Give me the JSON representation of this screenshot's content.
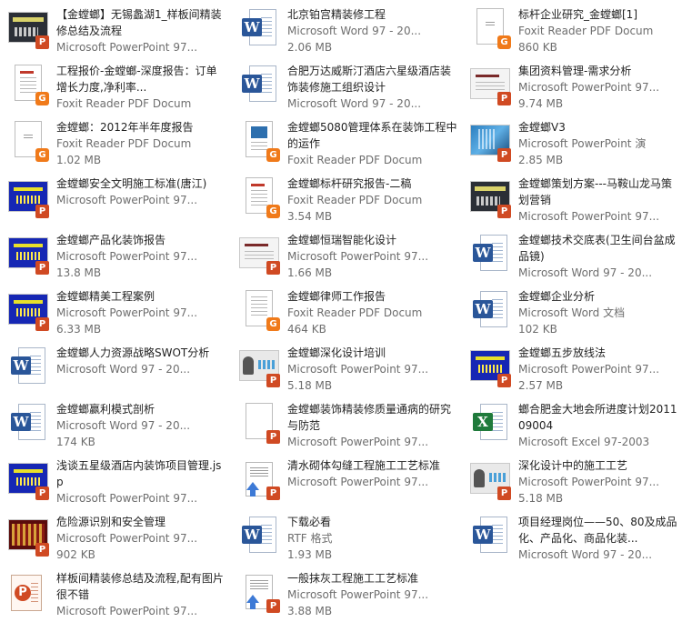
{
  "files": [
    {
      "name": "【金螳螂】无锡蠡湖1_样板间精装修总结及流程",
      "type": "Microsoft PowerPoint 97...",
      "size": "",
      "icon": "ppt-thumb-dark"
    },
    {
      "name": "北京铂宫精装修工程",
      "type": "Microsoft Word 97 - 20...",
      "size": "2.06 MB",
      "icon": "word-doc"
    },
    {
      "name": "标杆企业研究_金螳螂[1]",
      "type": "Foxit Reader PDF Docum",
      "size": "860 KB",
      "icon": "pdf-page-sparse"
    },
    {
      "name": "工程报价-金螳螂-深度报告：订单增长力度,净利率...",
      "type": "Foxit Reader PDF Docum",
      "size": "",
      "icon": "pdf-page-redhead"
    },
    {
      "name": "合肥万达威斯汀酒店六星级酒店装饰装修施工组织设计",
      "type": "Microsoft Word 97 - 20...",
      "size": "",
      "icon": "word-doc"
    },
    {
      "name": "集团资料管理-需求分析",
      "type": "Microsoft PowerPoint 97...",
      "size": "9.74 MB",
      "icon": "ppt-thumb-light"
    },
    {
      "name": "金螳螂：2012年半年度报告",
      "type": "Foxit Reader PDF Docum",
      "size": "1.02 MB",
      "icon": "pdf-page-sparse"
    },
    {
      "name": "金螳螂5080管理体系在装饰工程中的运作",
      "type": "Foxit Reader PDF Docum",
      "size": "",
      "icon": "pdf-page-cover"
    },
    {
      "name": "金螳螂V3",
      "type": "Microsoft PowerPoint 演",
      "size": "2.85 MB",
      "icon": "ppt-thumb-photo"
    },
    {
      "name": "金螳螂安全文明施工标准(唐江)",
      "type": "Microsoft PowerPoint 97...",
      "size": "",
      "icon": "ppt-thumb-blue"
    },
    {
      "name": "金螳螂标杆研究报告-二稿",
      "type": "Foxit Reader PDF Docum",
      "size": "3.54 MB",
      "icon": "pdf-page-redhead"
    },
    {
      "name": "金螳螂策划方案---马鞍山龙马策划营销",
      "type": "Microsoft PowerPoint 97...",
      "size": "",
      "icon": "ppt-thumb-dark"
    },
    {
      "name": "金螳螂产品化装饰报告",
      "type": "Microsoft PowerPoint 97...",
      "size": "13.8 MB",
      "icon": "ppt-thumb-blue"
    },
    {
      "name": "金螳螂恒瑞智能化设计",
      "type": "Microsoft PowerPoint 97...",
      "size": "1.66 MB",
      "icon": "ppt-thumb-light"
    },
    {
      "name": "金螳螂技术交底表(卫生间台盆成品镜)",
      "type": "Microsoft Word 97 - 20...",
      "size": "",
      "icon": "word-doc"
    },
    {
      "name": "金螳螂精美工程案例",
      "type": "Microsoft PowerPoint 97...",
      "size": "6.33 MB",
      "icon": "ppt-thumb-blue"
    },
    {
      "name": "金螳螂律师工作报告",
      "type": "Foxit Reader PDF Docum",
      "size": "464 KB",
      "icon": "pdf-page-lines"
    },
    {
      "name": "金螳螂企业分析",
      "type": "Microsoft Word 文档",
      "size": "102 KB",
      "icon": "word-doc"
    },
    {
      "name": "金螳螂人力资源战略SWOT分析",
      "type": "Microsoft Word 97 - 20...",
      "size": "",
      "icon": "word-doc"
    },
    {
      "name": "金螳螂深化设计培训",
      "type": "Microsoft PowerPoint 97...",
      "size": "5.18 MB",
      "icon": "ppt-thumb-greyphoto"
    },
    {
      "name": "金螳螂五步放线法",
      "type": "Microsoft PowerPoint 97...",
      "size": "2.57 MB",
      "icon": "ppt-thumb-blue"
    },
    {
      "name": "金螳螂赢利模式剖析",
      "type": "Microsoft Word 97 - 20...",
      "size": "174 KB",
      "icon": "word-doc"
    },
    {
      "name": "金螳螂装饰精装修质量通病的研究与防范",
      "type": "Microsoft PowerPoint 97...",
      "size": "",
      "icon": "ppt-page-blank"
    },
    {
      "name": "螂合肥金大地会所进度计划201109004",
      "type": "Microsoft Excel 97-2003",
      "size": "",
      "icon": "excel-doc"
    },
    {
      "name": "浅谈五星级酒店内装饰项目管理.jsp",
      "type": "Microsoft PowerPoint 97...",
      "size": "",
      "icon": "ppt-thumb-blue"
    },
    {
      "name": "清水砌体勾缝工程施工工艺标准",
      "type": "Microsoft PowerPoint 97...",
      "size": "",
      "icon": "ppt-wizard"
    },
    {
      "name": "深化设计中的施工工艺",
      "type": "Microsoft PowerPoint 97...",
      "size": "5.18 MB",
      "icon": "ppt-thumb-greyphoto"
    },
    {
      "name": "危险源识别和安全管理",
      "type": "Microsoft PowerPoint 97...",
      "size": "902 KB",
      "icon": "ppt-thumb-red"
    },
    {
      "name": "下载必看",
      "type": "RTF 格式",
      "size": "1.93 MB",
      "icon": "word-doc"
    },
    {
      "name": "项目经理岗位——50、80及成品化、产品化、商品化装...",
      "type": "Microsoft Word 97 - 20...",
      "size": "",
      "icon": "word-doc"
    },
    {
      "name": "样板间精装修总结及流程,配有图片很不错",
      "type": "Microsoft PowerPoint 97...",
      "size": "",
      "icon": "ppt-app"
    },
    {
      "name": "一般抹灰工程施工工艺标准",
      "type": "Microsoft PowerPoint 97...",
      "size": "3.88 MB",
      "icon": "ppt-wizard"
    }
  ]
}
